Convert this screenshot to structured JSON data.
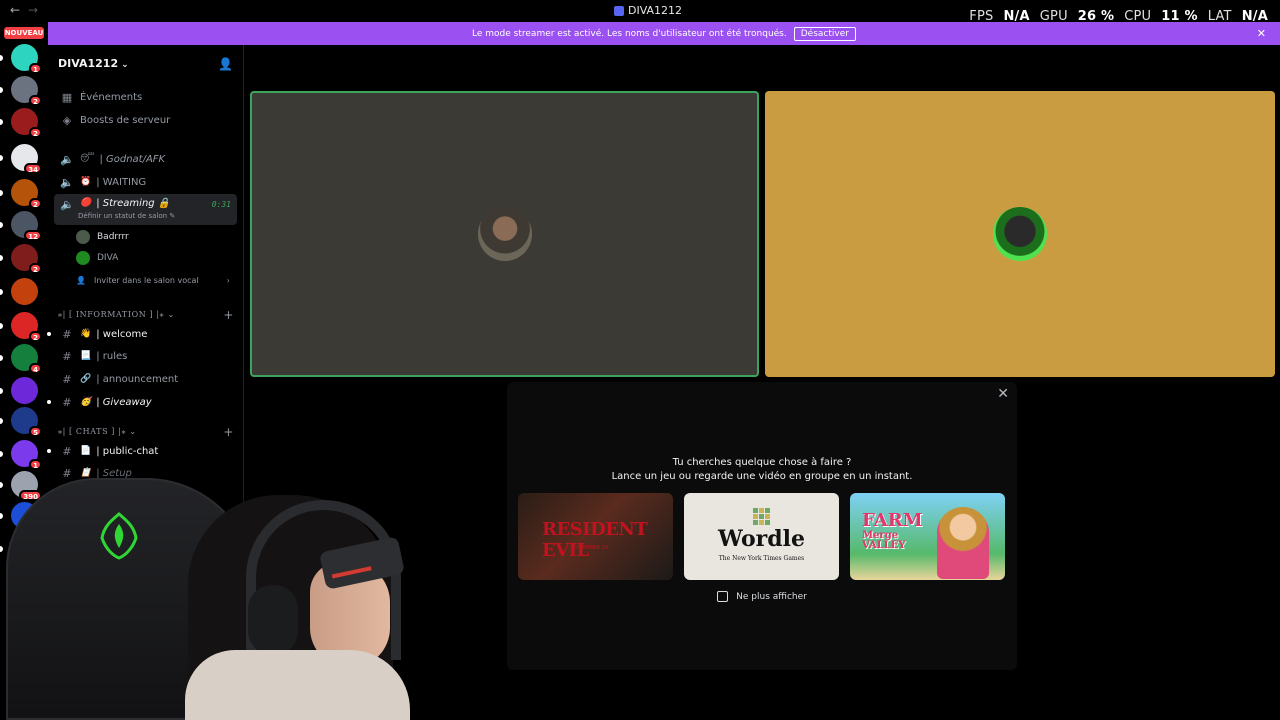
{
  "titlebar": {
    "title": "DIVA1212",
    "back": "←",
    "forward": "→"
  },
  "stats": {
    "fps_label": "FPS",
    "fps_value": "N/A",
    "gpu_label": "GPU",
    "gpu_value": "26 %",
    "cpu_label": "CPU",
    "cpu_value": "11 %",
    "lat_label": "LAT",
    "lat_value": "N/A"
  },
  "banner": {
    "message": "Le mode streamer est activé. Les noms d'utilisateur ont été tronqués.",
    "button": "Désactiver",
    "close": "✕"
  },
  "serverbar": {
    "new_label": "NOUVEAU",
    "servers": [
      {
        "badge": "1",
        "color": "#2dd4bf"
      },
      {
        "badge": "2",
        "color": "#6b7280"
      },
      {
        "badge": "2",
        "color": "#9a1c1c"
      },
      {
        "badge": "34",
        "color": "#e5e7eb"
      },
      {
        "badge": "2",
        "color": "#b45309"
      },
      {
        "badge": "12",
        "color": "#4b5563"
      },
      {
        "badge": "2",
        "color": "#7f1d1d"
      },
      {
        "badge": "",
        "color": "#c2410c"
      },
      {
        "badge": "2",
        "color": "#dc2626"
      },
      {
        "badge": "4",
        "color": "#15803d"
      },
      {
        "badge": "",
        "color": "#6d28d9"
      },
      {
        "badge": "5",
        "color": "#1e3a8a"
      },
      {
        "badge": "1",
        "color": "#7c3aed"
      },
      {
        "badge": "390",
        "color": "#9ca3af"
      },
      {
        "badge": "34",
        "color": "#1d4ed8"
      },
      {
        "badge": "",
        "color": "#92400e"
      }
    ]
  },
  "sidebar": {
    "guild_name": "DIVA1212",
    "events": "Événements",
    "boosts": "Boosts de serveur",
    "voice_channels": [
      {
        "emoji": "😴",
        "name": "| Godnat/AFK"
      },
      {
        "emoji": "⏰",
        "name": "| WAITING"
      },
      {
        "emoji": "🔴",
        "name": "| Streaming 🔒",
        "time": "0:31",
        "sub": "Définir un statut de salon ✎"
      }
    ],
    "members": [
      "Badrrrr",
      "DIVA"
    ],
    "invite": "Inviter dans le salon vocal",
    "categories": [
      {
        "name": "⁎| [ INFORMATION ] |⁎",
        "channels": [
          {
            "emoji": "👋",
            "name": "| welcome"
          },
          {
            "emoji": "📃",
            "name": "| rules"
          },
          {
            "emoji": "🔗",
            "name": "| announcement"
          },
          {
            "emoji": "🥳",
            "name": "| Giveaway"
          }
        ]
      },
      {
        "name": "⁎| [ CHATS ] |⁎",
        "channels": [
          {
            "emoji": "📄",
            "name": "| public-chat"
          },
          {
            "emoji": "📋",
            "name": "| Setup"
          }
        ]
      }
    ]
  },
  "activity": {
    "line1": "Tu cherches quelque chose à faire ?",
    "line2": "Lance un jeu ou regarde une vidéo en groupe en un instant.",
    "games": [
      {
        "title": "RESIDENT EVIL",
        "subtitle": "SEPTEMBER 19"
      },
      {
        "title": "Wordle",
        "subtitle": "The New York Times Games"
      },
      {
        "title": "FARM",
        "subtitle": "Merge VALLEY"
      }
    ],
    "dont_show": "Ne plus afficher"
  }
}
